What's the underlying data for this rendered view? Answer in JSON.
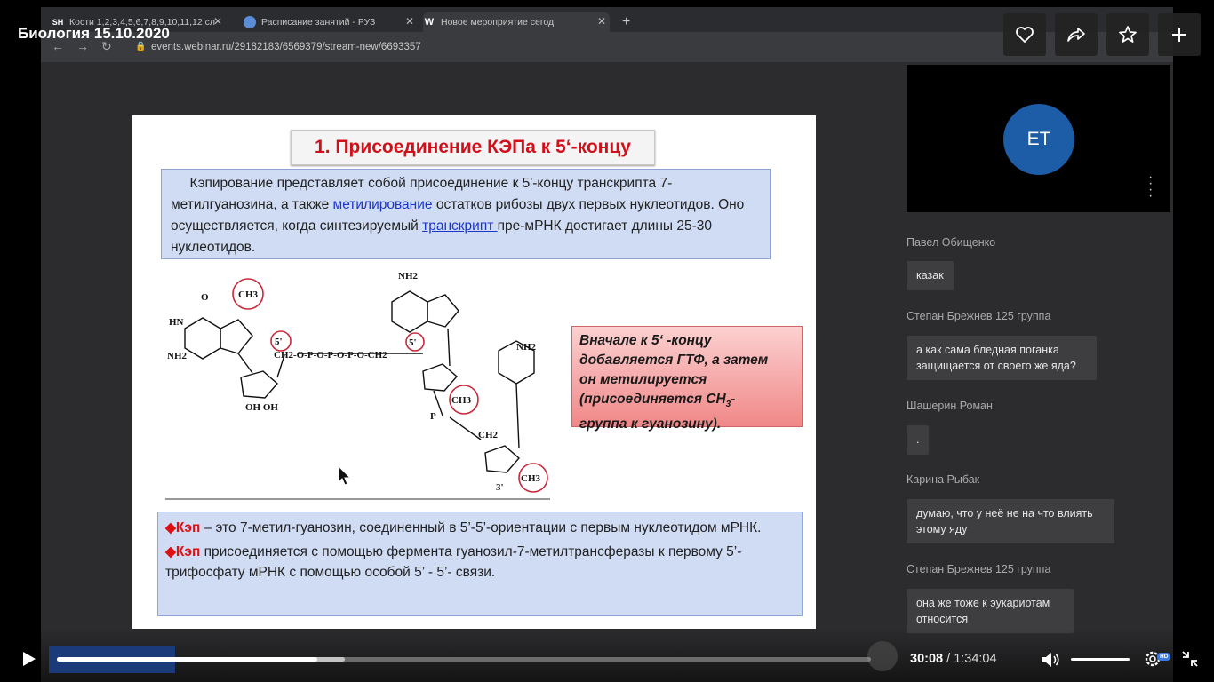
{
  "overlay": {
    "title": "Биология 15.10.2020",
    "buttons": [
      "heart-icon",
      "share-icon",
      "star-icon",
      "plus-icon"
    ]
  },
  "browser": {
    "tabs": [
      {
        "favicon": "SH",
        "label": "Кости 1,2,3,4,5,6,7,8,9,10,11,12 сл",
        "active": false
      },
      {
        "favicon": "globe-icon",
        "label": "Расписание занятий - РУЗ",
        "active": false
      },
      {
        "favicon": "W",
        "label": "Новое мероприятие сегод",
        "active": true
      }
    ],
    "new_tab_label": "+",
    "url": "events.webinar.ru/29182183/6569379/stream-new/6693357"
  },
  "slide": {
    "title": "1. Присоединение КЭПа к 5‘-концу",
    "para_part1": "Кэпирование представляет собой присоединение к 5'-концу транскрипта 7-метилгуанозина, а также ",
    "para_link1": "метилирование ",
    "para_part2": "остатков рибозы двух первых нуклеотидов. Оно осуществляется, когда синтезируемый ",
    "para_link2": "транскрипт ",
    "para_part3": "пре-мРНК достигает длины 25-30 нуклеотидов.",
    "pink_line1": "Вначале к 5‘ -концу",
    "pink_line2": "добавляется ГТФ, а затем",
    "pink_line3": "он метилируется",
    "pink_line4_a": "(присоединяется СН",
    "pink_line4_sub": "3",
    "pink_line4_b": "-",
    "pink_line5": "группа к гуанозину).",
    "bullet1_key": "Кэп",
    "bullet1_text": " – это 7-метил-гуанозин, соединенный в 5’-5’-ориентации с первым нуклеотидом мРНК.",
    "bullet2_key": "Кэп",
    "bullet2_text": " присоединяется с помощью фермента гуанозил-7-метилтрансферазы к первому 5’-трифосфату мРНК  с помощью особой 5’ - 5’- связи.",
    "chem_labels": {
      "ch3": "CH3",
      "nh2": "NH2",
      "five": "5'",
      "ohoh": "OH OH",
      "ch2": "CH2",
      "o": "O",
      "p": "P",
      "hn": "HN",
      "n": "N",
      "ch2_o": "CH2-O-P-O-P-O-P-O-CH2",
      "three": "3'"
    }
  },
  "participant": {
    "initials": "ET"
  },
  "chat": [
    {
      "name": "Павел Обищенко",
      "text": "казак"
    },
    {
      "name": "Степан Брежнев 125 группа",
      "text": "а как сама бледная поганка защищается от своего же яда?"
    },
    {
      "name": "Шашерин Роман",
      "text": "."
    },
    {
      "name": "Карина Рыбак",
      "text": "думаю, что у неё не на что влиять этому яду"
    },
    {
      "name": "Степан Брежнев 125 группа",
      "text": "она же тоже к эукариотам относится"
    }
  ],
  "player": {
    "current": "30:08",
    "separator": " / ",
    "total": "1:34:04",
    "progress_fraction": 0.32,
    "buffered_fraction": 0.354,
    "hd_badge": "HD"
  },
  "colors": {
    "slide_title_red": "#d0101a",
    "box_blue": "#d0dcf4",
    "avatar_blue": "#1d5da7",
    "link_blue": "#1c36c8"
  }
}
